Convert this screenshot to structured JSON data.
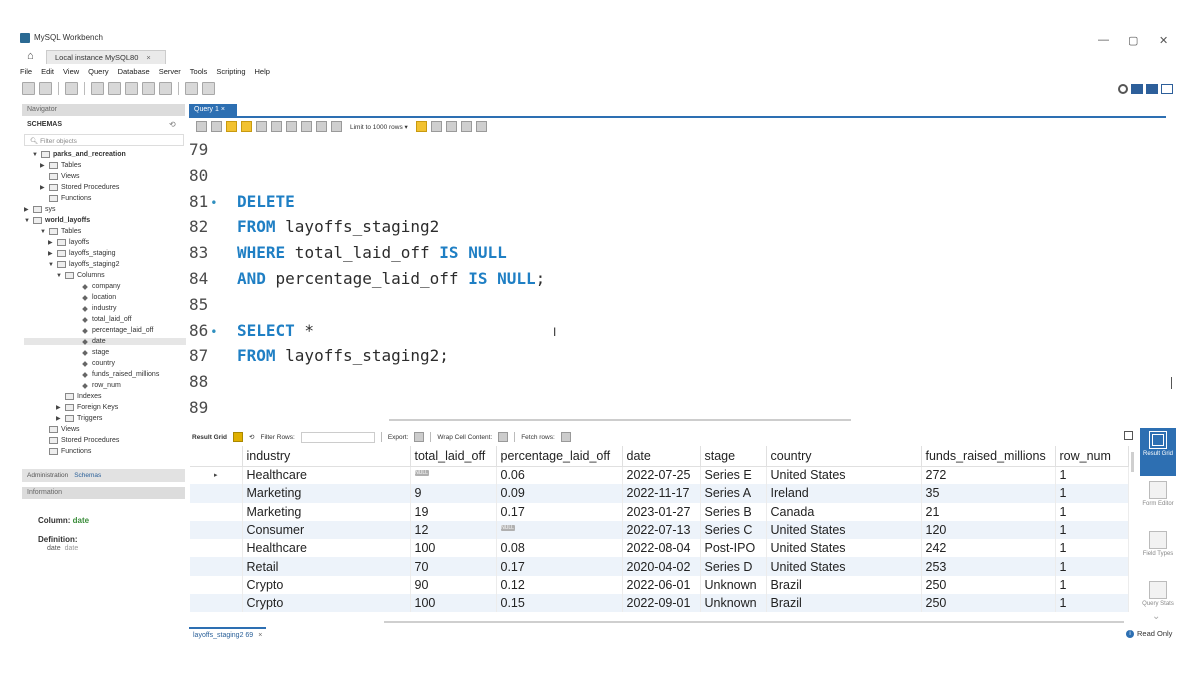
{
  "window": {
    "title": "MySQL Workbench",
    "controls": [
      "—",
      "▢",
      "✕"
    ]
  },
  "connection_tab": {
    "label": "Local instance MySQL80",
    "close": "×"
  },
  "menu": [
    "File",
    "Edit",
    "View",
    "Query",
    "Database",
    "Server",
    "Tools",
    "Scripting",
    "Help"
  ],
  "navigator": {
    "header": "Navigator",
    "schemas_label": "SCHEMAS",
    "filter_placeholder": "Filter objects",
    "tree": [
      {
        "label": "parks_and_recreation",
        "twisty": "▼"
      },
      {
        "label": "Tables",
        "twisty": "▶"
      },
      {
        "label": "Views",
        "twisty": ""
      },
      {
        "label": "Stored Procedures",
        "twisty": "▶"
      },
      {
        "label": "Functions",
        "twisty": ""
      },
      {
        "label": "sys",
        "twisty": "▶"
      },
      {
        "label": "world_layoffs",
        "twisty": "▼"
      },
      {
        "label": "Tables",
        "twisty": "▼"
      },
      {
        "label": "layoffs",
        "twisty": "▶"
      },
      {
        "label": "layoffs_staging",
        "twisty": "▶"
      },
      {
        "label": "layoffs_staging2",
        "twisty": "▼"
      },
      {
        "label": "Columns",
        "twisty": "▼"
      },
      {
        "label": "company",
        "twisty": ""
      },
      {
        "label": "location",
        "twisty": ""
      },
      {
        "label": "industry",
        "twisty": ""
      },
      {
        "label": "total_laid_off",
        "twisty": ""
      },
      {
        "label": "percentage_laid_off",
        "twisty": ""
      },
      {
        "label": "date",
        "twisty": ""
      },
      {
        "label": "stage",
        "twisty": ""
      },
      {
        "label": "country",
        "twisty": ""
      },
      {
        "label": "funds_raised_millions",
        "twisty": ""
      },
      {
        "label": "row_num",
        "twisty": ""
      },
      {
        "label": "Indexes",
        "twisty": ""
      },
      {
        "label": "Foreign Keys",
        "twisty": "▶"
      },
      {
        "label": "Triggers",
        "twisty": "▶"
      },
      {
        "label": "Views",
        "twisty": ""
      },
      {
        "label": "Stored Procedures",
        "twisty": ""
      },
      {
        "label": "Functions",
        "twisty": ""
      }
    ]
  },
  "admin_tabs": [
    "Administration",
    "Schemas"
  ],
  "information": {
    "header": "Information",
    "column_label": "Column:",
    "column_value": "date",
    "definition_label": "Definition:",
    "definition_name": "date",
    "definition_type": "date"
  },
  "editor": {
    "tab_label": "Query 1",
    "tab_close": "×",
    "limit_label": "Limit to 1000 rows",
    "lines": [
      {
        "num": "79",
        "bullet": "",
        "tokens": []
      },
      {
        "num": "80",
        "bullet": "",
        "tokens": []
      },
      {
        "num": "81",
        "bullet": "•",
        "tokens": [
          {
            "t": "DELETE",
            "kw": true
          }
        ]
      },
      {
        "num": "82",
        "bullet": "",
        "tokens": [
          {
            "t": "FROM",
            "kw": true
          },
          {
            "t": " layoffs_staging2",
            "kw": false
          }
        ]
      },
      {
        "num": "83",
        "bullet": "",
        "tokens": [
          {
            "t": "WHERE",
            "kw": true
          },
          {
            "t": " total_laid_off ",
            "kw": false
          },
          {
            "t": "IS NULL",
            "kw": true
          }
        ]
      },
      {
        "num": "84",
        "bullet": "",
        "tokens": [
          {
            "t": "AND",
            "kw": true
          },
          {
            "t": " percentage_laid_off ",
            "kw": false
          },
          {
            "t": "IS NULL",
            "kw": true
          },
          {
            "t": ";",
            "kw": false
          }
        ]
      },
      {
        "num": "85",
        "bullet": "",
        "tokens": []
      },
      {
        "num": "86",
        "bullet": "•",
        "tokens": [
          {
            "t": "SELECT",
            "kw": true
          },
          {
            "t": " *",
            "kw": false
          }
        ]
      },
      {
        "num": "87",
        "bullet": "",
        "tokens": [
          {
            "t": "FROM",
            "kw": true
          },
          {
            "t": " layoffs_staging2;",
            "kw": false
          }
        ]
      },
      {
        "num": "88",
        "bullet": "",
        "tokens": []
      },
      {
        "num": "89",
        "bullet": "",
        "tokens": []
      }
    ]
  },
  "results_toolbar": {
    "result_grid": "Result Grid",
    "filter_rows": "Filter Rows:",
    "export": "Export:",
    "wrap": "Wrap Cell Content:",
    "fetch": "Fetch rows:"
  },
  "grid": {
    "columns": [
      "",
      "industry",
      "total_laid_off",
      "percentage_laid_off",
      "date",
      "stage",
      "country",
      "funds_raised_millions",
      "row_num"
    ],
    "null_text": "NULL",
    "rows": [
      [
        "▸",
        "Healthcare",
        null,
        "0.06",
        "2022-07-25",
        "Series E",
        "United States",
        "272",
        "1"
      ],
      [
        "",
        "Marketing",
        "9",
        "0.09",
        "2022-11-17",
        "Series A",
        "Ireland",
        "35",
        "1"
      ],
      [
        "",
        "Marketing",
        "19",
        "0.17",
        "2023-01-27",
        "Series B",
        "Canada",
        "21",
        "1"
      ],
      [
        "",
        "Consumer",
        "12",
        null,
        "2022-07-13",
        "Series C",
        "United States",
        "120",
        "1"
      ],
      [
        "",
        "Healthcare",
        "100",
        "0.08",
        "2022-08-04",
        "Post-IPO",
        "United States",
        "242",
        "1"
      ],
      [
        "",
        "Retail",
        "70",
        "0.17",
        "2020-04-02",
        "Series D",
        "United States",
        "253",
        "1"
      ],
      [
        "",
        "Crypto",
        "90",
        "0.12",
        "2022-06-01",
        "Unknown",
        "Brazil",
        "250",
        "1"
      ],
      [
        "",
        "Crypto",
        "100",
        "0.15",
        "2022-09-01",
        "Unknown",
        "Brazil",
        "250",
        "1"
      ]
    ]
  },
  "side_panel": [
    {
      "label": "Result Grid",
      "icon": "grid-icon",
      "active": true
    },
    {
      "label": "Form Editor",
      "icon": "form-icon",
      "active": false
    },
    {
      "label": "Field Types",
      "icon": "field-types-icon",
      "active": false
    },
    {
      "label": "Query Stats",
      "icon": "stats-icon",
      "active": false
    }
  ],
  "bottom_tab": {
    "label": "layoffs_staging2 69",
    "close": "×"
  },
  "status": {
    "read_only": "Read Only"
  },
  "colors": {
    "accent": "#2d6fb2",
    "keyword": "#1f7fc4",
    "row_alt": "#edf3fa"
  }
}
